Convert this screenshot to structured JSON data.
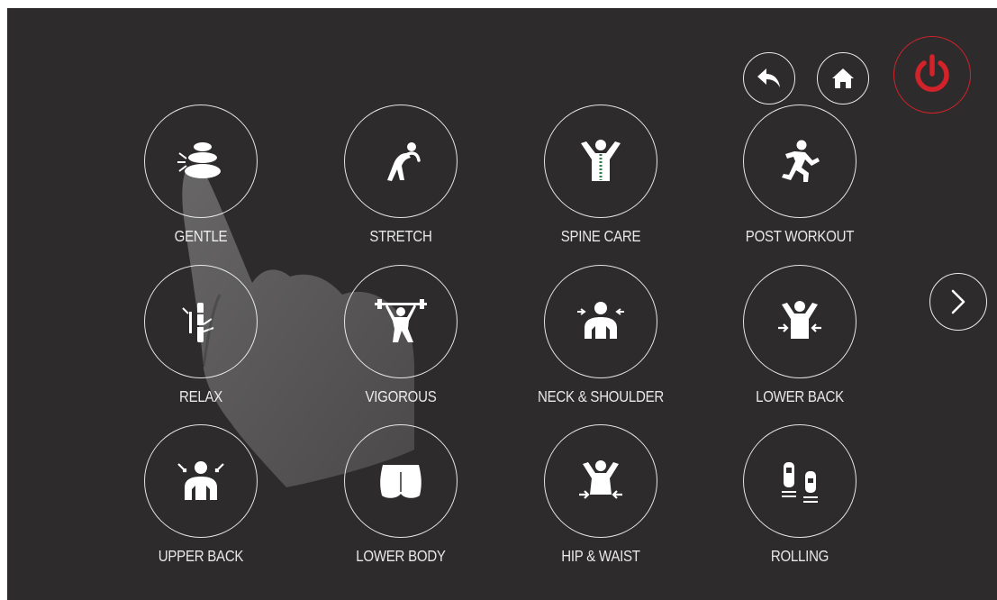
{
  "top_controls": {
    "back_icon": "back-arrow-icon",
    "home_icon": "home-icon",
    "power_icon": "power-icon",
    "power_color": "#d2232a"
  },
  "next_icon": "chevron-right-icon",
  "programs": [
    {
      "label": "GENTLE",
      "icon": "stacked-stones-icon"
    },
    {
      "label": "STRETCH",
      "icon": "stretching-figure-icon"
    },
    {
      "label": "SPINE CARE",
      "icon": "spine-figure-icon"
    },
    {
      "label": "POST WORKOUT",
      "icon": "running-figure-icon"
    },
    {
      "label": "RELAX",
      "icon": "bamboo-icon"
    },
    {
      "label": "VIGOROUS",
      "icon": "weightlifter-icon"
    },
    {
      "label": "NECK & SHOULDER",
      "icon": "neck-shoulder-icon"
    },
    {
      "label": "LOWER BACK",
      "icon": "lower-back-icon"
    },
    {
      "label": "UPPER BACK",
      "icon": "upper-back-icon"
    },
    {
      "label": "LOWER BODY",
      "icon": "lower-body-icon"
    },
    {
      "label": "HIP & WAIST",
      "icon": "hip-waist-icon"
    },
    {
      "label": "ROLLING",
      "icon": "rolling-rollers-icon"
    }
  ],
  "colors": {
    "background": "#2d2b2c",
    "outline": "#e4e4e4",
    "text": "#e8e8e8"
  }
}
